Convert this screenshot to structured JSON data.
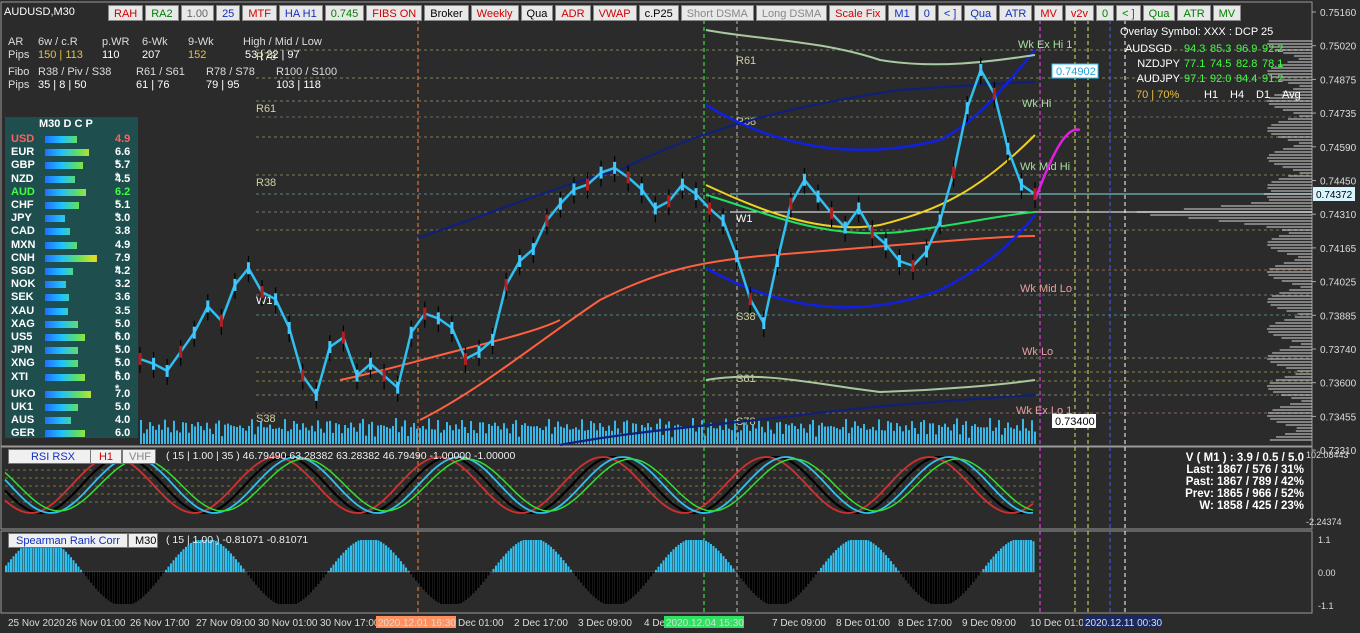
{
  "window": {
    "symbol": "AUDUSD,M30"
  },
  "toolbar": [
    {
      "label": "RAH",
      "color": "#d00000"
    },
    {
      "label": "RA2",
      "color": "#008000"
    },
    {
      "label": "1.00",
      "color": "#666"
    },
    {
      "label": "25",
      "color": "#1030c0"
    },
    {
      "label": "MTF",
      "color": "#d00000"
    },
    {
      "label": "HA H1",
      "color": "#1030c0"
    },
    {
      "label": "0.745",
      "color": "#008000"
    },
    {
      "label": "FIBS ON",
      "color": "#d00000"
    },
    {
      "label": "Broker",
      "color": "#000"
    },
    {
      "label": "Weekly",
      "color": "#d00000"
    },
    {
      "label": "Qua",
      "color": "#000"
    },
    {
      "label": "ADR",
      "color": "#d00000"
    },
    {
      "label": "VWAP",
      "color": "#d00000"
    },
    {
      "label": "c.P25",
      "color": "#000"
    },
    {
      "label": "Short DSMA",
      "color": "#888"
    },
    {
      "label": "Long DSMA",
      "color": "#888"
    },
    {
      "label": "Scale Fix",
      "color": "#d00000"
    },
    {
      "label": "M1",
      "color": "#1030c0"
    },
    {
      "label": "0",
      "color": "#1030c0"
    },
    {
      "label": "< ]",
      "color": "#1030c0"
    },
    {
      "label": "Qua",
      "color": "#1030c0"
    },
    {
      "label": "ATR",
      "color": "#1030c0"
    },
    {
      "label": "MV",
      "color": "#d00000"
    },
    {
      "label": "v2v",
      "color": "#d00000"
    },
    {
      "label": "0",
      "color": "#008000"
    },
    {
      "label": "< ]",
      "color": "#008000"
    },
    {
      "label": "Qua",
      "color": "#008000"
    },
    {
      "label": "ATR",
      "color": "#008000"
    },
    {
      "label": "MV",
      "color": "#008000"
    }
  ],
  "info": {
    "row1": {
      "a": "AR",
      "b": "6w / c.R",
      "c": "p.WR",
      "d": "6-Wk",
      "e": "9-Wk",
      "f": "High / Mid / Low"
    },
    "row2": {
      "a": "Pips",
      "b": "150 | 113",
      "c": "110",
      "d": "207",
      "e": "152",
      "f": "53 | 22 | 97"
    },
    "row3": {
      "a": "Fibo",
      "b": "R38 / Piv / S38",
      "c": "R61 / S61",
      "d": "R78 / S78",
      "e": "R100 / S100"
    },
    "row4": {
      "a": "Pips",
      "b": "35 | 8 | 50",
      "c": "61 | 76",
      "d": "79 | 95",
      "e": "103 | 118"
    }
  },
  "strength": {
    "header": "M30  D C P",
    "rows": [
      {
        "name": "USD",
        "value": "4.9",
        "color": "#ff6060",
        "bar": 0.49
      },
      {
        "name": "EUR",
        "value": "6.6 *",
        "color": "#ffffff",
        "bar": 0.66
      },
      {
        "name": "GBP",
        "value": "5.7 *",
        "color": "#ffffff",
        "bar": 0.57
      },
      {
        "name": "NZD",
        "value": "4.5",
        "color": "#ffffff",
        "bar": 0.45
      },
      {
        "name": "AUD",
        "value": "6.2 *",
        "color": "#40ff40",
        "bar": 0.62
      },
      {
        "name": "CHF",
        "value": "5.1 *",
        "color": "#ffffff",
        "bar": 0.51
      },
      {
        "name": "JPY",
        "value": "3.0",
        "color": "#ffffff",
        "bar": 0.3
      },
      {
        "name": "CAD",
        "value": "3.8",
        "color": "#ffffff",
        "bar": 0.38
      },
      {
        "name": "MXN",
        "value": "4.9",
        "color": "#ffffff",
        "bar": 0.49
      },
      {
        "name": "CNH",
        "value": "7.9 *",
        "color": "#ffffff",
        "bar": 0.79
      },
      {
        "name": "SGD",
        "value": "4.2",
        "color": "#ffffff",
        "bar": 0.42
      },
      {
        "name": "NOK",
        "value": "3.2",
        "color": "#ffffff",
        "bar": 0.32
      },
      {
        "name": "SEK",
        "value": "3.6",
        "color": "#ffffff",
        "bar": 0.36
      },
      {
        "name": "XAU",
        "value": "3.5",
        "color": "#ffffff",
        "bar": 0.35
      },
      {
        "name": "XAG",
        "value": "5.0 *",
        "color": "#ffffff",
        "bar": 0.5
      },
      {
        "name": "US5",
        "value": "6.0 *",
        "color": "#ffffff",
        "bar": 0.6
      },
      {
        "name": "JPN",
        "value": "5.0 *",
        "color": "#ffffff",
        "bar": 0.5
      },
      {
        "name": "XNG",
        "value": "5.0 *",
        "color": "#ffffff",
        "bar": 0.5
      },
      {
        "name": "XTI",
        "value": "6.0 *",
        "color": "#ffffff",
        "bar": 0.6
      },
      {
        "name": "UKO",
        "value": "7.0",
        "color": "#ffffff",
        "bar": 0.7
      },
      {
        "name": "UK1",
        "value": "5.0",
        "color": "#ffffff",
        "bar": 0.5
      },
      {
        "name": "AUS",
        "value": "4.0",
        "color": "#ffffff",
        "bar": 0.4
      },
      {
        "name": "GER",
        "value": "6.0",
        "color": "#ffffff",
        "bar": 0.6
      }
    ]
  },
  "overlay": {
    "title": "Overlay Symbol: XXX : DCP 25",
    "rows": [
      {
        "sym": "AUDSGD",
        "vals": [
          "94.3",
          "85.3",
          "96.9",
          "92.2"
        ]
      },
      {
        "sym": "NZDJPY",
        "vals": [
          "77.1",
          "74.5",
          "82.8",
          "78.1"
        ]
      },
      {
        "sym": "AUDJPY",
        "vals": [
          "97.1",
          "92.0",
          "84.4",
          "91.2"
        ]
      }
    ],
    "footer": {
      "ratio": "70 | 70%",
      "cols": [
        "H1",
        "H4",
        "D1",
        "Avg"
      ]
    }
  },
  "vstats": {
    "line1": "V ( M1 ) : 3.9 / 0.5 / 5.0",
    "line2": "Last: 1867 / 576 / 31%",
    "line3": "Past: 1867 / 789 / 42%",
    "line4": "Prev: 1865 / 966 / 52%",
    "line5": "W: 1858 / 425 / 23%"
  },
  "levels": {
    "wk_ex_hi_1": "Wk Ex Hi 1",
    "wk_hi": "Wk Hi",
    "wk_mid_hi": "Wk Mid Hi",
    "wk_mid_lo": "Wk Mid Lo",
    "wk_lo": "Wk Lo",
    "wk_ex_lo_1": "Wk Ex Lo 1",
    "r61": "R61",
    "r38": "R38",
    "s38": "S38",
    "s61": "S61",
    "s78": "S78",
    "r78": "R78",
    "w1": "W1"
  },
  "price_tags": {
    "top": "0.74902",
    "mid": "0.74372",
    "low": "0.73400"
  },
  "rsi_panel": {
    "label": "RSI RSX",
    "tf": "H1",
    "extra": "VHF",
    "params": "( 15 | 1.00 | 35 ) 46.79490 63.28382 63.28382 46.79490 -1.00000 -1.00000",
    "scale_top": "102.08443",
    "scale_bot": "-2.24374"
  },
  "spearman_panel": {
    "label": "Spearman Rank Corr",
    "tf": "M30",
    "params": "( 15 | 1.00 ) -0.81071 -0.81071",
    "scale": [
      "1.1",
      "0.00",
      "-1.1"
    ]
  },
  "x_axis": [
    "25 Nov 2020",
    "26 Nov 01:00",
    "26 Nov 17:00",
    "27 Nov 09:00",
    "30 Nov 01:00",
    "30 Nov 17:00",
    "2020.12.01 16:30",
    "Dec 01:00",
    "2 Dec 17:00",
    "3 Dec 09:00",
    "4 Dec",
    "2020.12.04 15:30",
    "7 Dec 09:00",
    "8 Dec 01:00",
    "8 Dec 17:00",
    "9 Dec 09:00",
    "10 Dec 01:00",
    "2020.12.11 00:30"
  ],
  "chart_data": {
    "type": "line",
    "title": "",
    "ylabel": "",
    "ylim": [
      0.7331,
      0.7516
    ],
    "yticks": [
      "0.75160",
      "0.75020",
      "0.74875",
      "0.74735",
      "0.74590",
      "0.74450",
      "0.74310",
      "0.74165",
      "0.74025",
      "0.73885",
      "0.73740",
      "0.73600",
      "0.73455",
      "0.73310"
    ],
    "series": [
      {
        "name": "",
        "values": [
          0.7367,
          0.7365,
          0.7362,
          0.737,
          0.7378,
          0.7389,
          0.7383,
          0.7398,
          0.7405,
          0.7395,
          0.7392,
          0.738,
          0.736,
          0.7352,
          0.7372,
          0.7376,
          0.736,
          0.7365,
          0.736,
          0.7355,
          0.7378,
          0.7386,
          0.7384,
          0.738,
          0.7367,
          0.737,
          0.7375,
          0.7398,
          0.7408,
          0.7413,
          0.7425,
          0.7432,
          0.7438,
          0.744,
          0.7445,
          0.7447,
          0.7443,
          0.7438,
          0.743,
          0.7433,
          0.744,
          0.7436,
          0.743,
          0.7425,
          0.741,
          0.7392,
          0.7382,
          0.7408,
          0.7432,
          0.7442,
          0.7435,
          0.7428,
          0.7422,
          0.743,
          0.742,
          0.7415,
          0.7408,
          0.7406,
          0.7412,
          0.7425,
          0.7445,
          0.7472,
          0.7488,
          0.7478,
          0.7455,
          0.744,
          0.7436
        ]
      }
    ]
  }
}
